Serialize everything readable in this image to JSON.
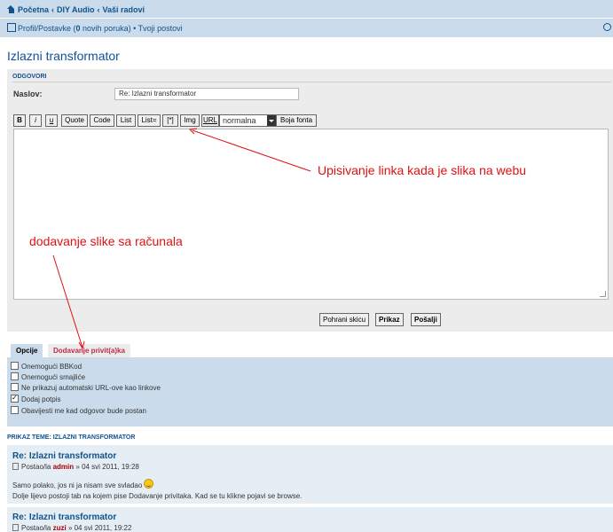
{
  "nav": {
    "breadcrumbs": [
      "Početna",
      "DIY Audio",
      "Vaši radovi"
    ],
    "breadcrumb_sep": "‹",
    "userlinks_prefix": "Profil/Postavke (",
    "new_messages_count": "0",
    "new_messages_suffix": " novih poruka)",
    "bullet": "•",
    "your_posts": "Tvoji postovi"
  },
  "page_title": "Izlazni transformator",
  "reply_panel": {
    "header": "ODGOVORI",
    "subject_label": "Naslov:",
    "subject_value": "Re: Izlazni transformator"
  },
  "toolbar": {
    "buttons": [
      "B",
      "i",
      "u",
      "Quote",
      "Code",
      "List",
      "List=",
      "[*]",
      "Img",
      "URL"
    ],
    "font_size_selected": "normalna",
    "font_color_button": "Boja fonta"
  },
  "actions": {
    "save_draft": "Pohrani skicu",
    "preview": "Prikaz",
    "submit": "Pošalji"
  },
  "tabs": {
    "options": "Opcije",
    "attachments": "Dodavanje privit(a)ka"
  },
  "options": [
    {
      "label": "Onemogući BBKod",
      "checked": false
    },
    {
      "label": "Onemogući smajliće",
      "checked": false
    },
    {
      "label": "Ne prikazuj automatski URL-ove kao linkove",
      "checked": false
    },
    {
      "label": "Dodaj potpis",
      "checked": true
    },
    {
      "label": "Obavijesti me kad odgovor bude postan",
      "checked": false
    }
  ],
  "topic_review": {
    "header": "PRIKAZ TEME: IZLAZNI TRANSFORMATOR",
    "posts": [
      {
        "title": "Re: Izlazni transformator",
        "meta_prefix": "Postao/la",
        "author": "admin",
        "date": "» 04 svi 2011, 19:28",
        "lines": [
          "Samo polako, jos ni ja nisam sve svladao",
          "Dolje lijevo postoji tab na kojem pise Dodavanje privitaka. Kad se tu klikne pojavi se browse."
        ]
      },
      {
        "title": "Re: Izlazni transformator",
        "meta_prefix": "Postao/la",
        "author": "zuzi",
        "date": "» 04 svi 2011, 19:22"
      }
    ]
  },
  "annotations": {
    "web_image": "Upisivanje linka kada je slika na webu",
    "local_image": "dodavanje slike sa računala"
  },
  "colors": {
    "navbar": "#cadceb",
    "link": "#105289",
    "annotation": "#e01010",
    "tab_link": "#bc2a4d"
  }
}
